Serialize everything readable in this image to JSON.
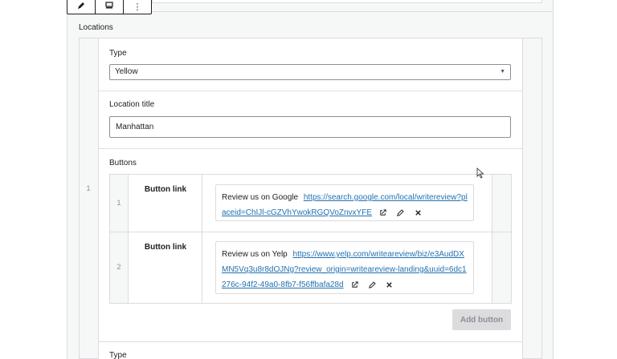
{
  "toolbar": {
    "edit_icon": "pencil-icon",
    "block_icon": "block-icon",
    "more_label": "⋮"
  },
  "locations": {
    "label": "Locations",
    "rows": [
      {
        "index": "1",
        "type_label": "Type",
        "type_value": "Yellow",
        "title_label": "Location title",
        "title_value": "Manhattan",
        "buttons_label": "Buttons",
        "buttons": [
          {
            "index": "1",
            "label": "Button link",
            "link_text": "Review us on Google",
            "link_url": "https://search.google.com/local/writereview?placeid=ChIJl-cGZVhYwokRGQVoZnvxYFE"
          },
          {
            "index": "2",
            "label": "Button link",
            "link_text": "Review us on Yelp",
            "link_url": "https://www.yelp.com/writeareview/biz/e3AudDXMN5Vq3u8r8dOJNg?review_origin=writeareview-landing&uuid=6dc1276c-94f2-49a0-8fb7-f56ffbafa28d"
          }
        ],
        "add_button_label": "Add button"
      }
    ],
    "next_row_type_label": "Type"
  },
  "icons": {
    "open_link": "external-link-icon",
    "edit_link": "pencil-icon",
    "remove_link": "close-icon"
  }
}
